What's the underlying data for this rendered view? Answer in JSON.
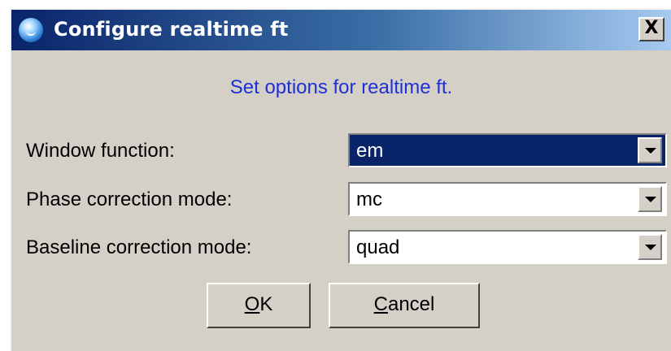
{
  "window": {
    "title": "Configure realtime ft",
    "close_label": "X"
  },
  "subtitle": "Set options for realtime ft.",
  "fields": [
    {
      "label": "Window function:",
      "value": "em",
      "selected": true
    },
    {
      "label": "Phase correction mode:",
      "value": "mc",
      "selected": false
    },
    {
      "label": "Baseline correction mode:",
      "value": "quad",
      "selected": false
    }
  ],
  "buttons": {
    "ok": {
      "mnemonic": "O",
      "rest": "K"
    },
    "cancel": {
      "mnemonic": "C",
      "rest": "ancel"
    }
  },
  "colors": {
    "title_bar": "#0a246a",
    "subtitle_text": "#1f2fd6",
    "selection": "#0a246a",
    "dialog_bg": "#d4d0c8"
  }
}
